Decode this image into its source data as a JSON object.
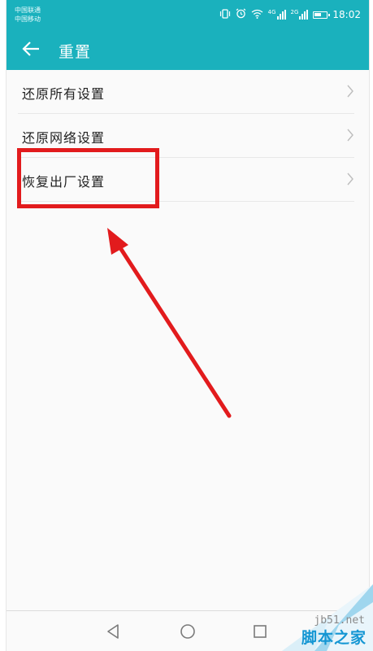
{
  "status_bar": {
    "carrier_1": "中国联通",
    "carrier_2": "中国移动",
    "network_1": "4G",
    "network_2": "2G",
    "time": "18:02",
    "icons": [
      "vibrate-icon",
      "alarm-icon",
      "wifi-icon",
      "signal-icon",
      "battery-icon"
    ]
  },
  "header": {
    "back_icon": "arrow-left-icon",
    "title": "重置"
  },
  "settings": {
    "items": [
      {
        "label": "还原所有设置"
      },
      {
        "label": "还原网络设置"
      },
      {
        "label": "恢复出厂设置"
      }
    ]
  },
  "navigation_bar": {
    "buttons": [
      "back-triangle-icon",
      "home-circle-icon",
      "recents-square-icon"
    ]
  },
  "annotations": {
    "highlight_color": "#e21b1d",
    "highlighted_item": "恢复出厂设置"
  },
  "watermark": {
    "site": "jb51.net",
    "name": "脚本之家"
  },
  "colors": {
    "accent": "#1ab1bd",
    "text": "#222222",
    "chevron": "#bdbdbd"
  }
}
